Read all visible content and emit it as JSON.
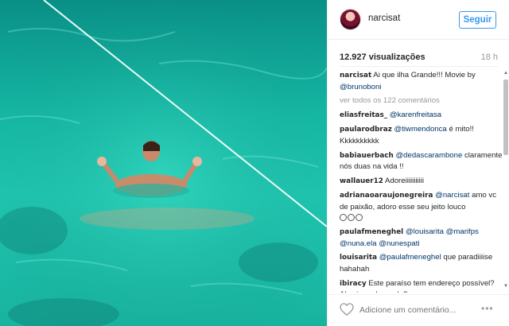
{
  "post": {
    "username": "narcisat",
    "follow_label": "Seguir",
    "views": "12.927 visualizações",
    "time": "18 h",
    "view_all": "ver todos os 122 comentários",
    "add_comment_placeholder": "Adicione um comentário...",
    "more_label": "•••"
  },
  "caption": {
    "user": "narcisat",
    "text": "Ai que ilha Grande!!! Movie by",
    "mention": "@brunoboni"
  },
  "comments": [
    {
      "user": "eliasfreitas_",
      "mention": "@karenfreitasa",
      "text": ""
    },
    {
      "user": "paularodbraz",
      "mention": "@tiwmendonca",
      "text": " é mito!! Kkkkkkkkkk"
    },
    {
      "user": "babiauerbach",
      "mention": "@dedascarambone",
      "text": " claramente nós duas na vida !!"
    },
    {
      "user": "wallauer12",
      "mention": "",
      "text": "Adoreiiiiiiiiiii"
    },
    {
      "user": "adrianaoaraujonegreira",
      "mention": "@narcisat",
      "text": " amo vc de paixão, adoro esse seu jeito louco"
    },
    {
      "user": "paulafmeneghel",
      "mention": "@louisarita @marifps @nuna.ela @nunespati",
      "text": ""
    },
    {
      "user": "louisarita",
      "mention": "@paulafmeneghel",
      "text": " que paradiiiise hahahah"
    },
    {
      "user": "ibiracy",
      "mention": "",
      "text": "Este paraíso tem endereço possível? Alguém sabe onde?"
    }
  ],
  "colors": {
    "accent": "#3897f0",
    "mention": "#003569",
    "water": "#1cbfaa"
  },
  "icons": {
    "heart": "heart-icon",
    "avatar": "avatar",
    "scroll_up": "scroll-up-arrow",
    "scroll_down": "scroll-down-arrow"
  }
}
